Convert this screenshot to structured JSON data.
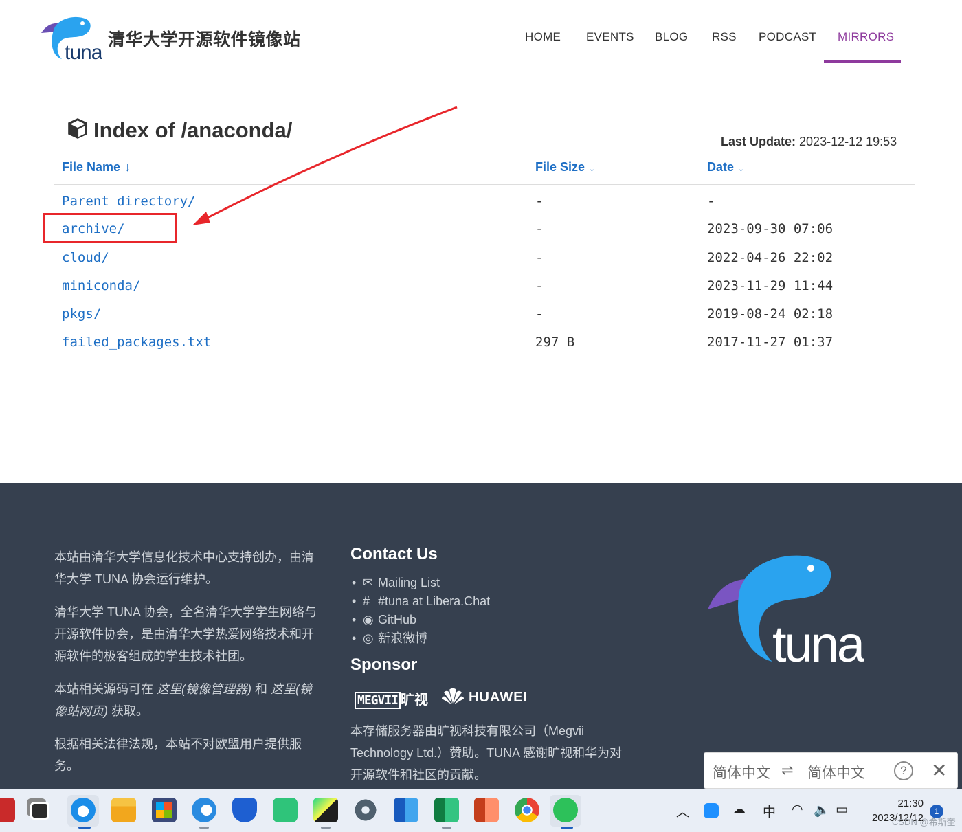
{
  "header": {
    "site_title": "清华大学开源软件镜像站",
    "logo_text": "tuna",
    "nav": [
      {
        "label": "HOME",
        "active": false
      },
      {
        "label": "EVENTS",
        "active": false
      },
      {
        "label": "BLOG",
        "active": false
      },
      {
        "label": "RSS",
        "active": false
      },
      {
        "label": "PODCAST",
        "active": false
      },
      {
        "label": "MIRRORS",
        "active": true
      }
    ],
    "accent_color": "#8e3a9d"
  },
  "index": {
    "title": "Index of /anaconda/",
    "last_update_label": "Last Update:",
    "last_update_value": "2023-12-12 19:53",
    "columns": {
      "name": "File Name",
      "size": "File Size",
      "date": "Date",
      "sort_arrow": "↓"
    },
    "rows": [
      {
        "name": "Parent directory/",
        "size": "-",
        "date": "-"
      },
      {
        "name": "archive/",
        "size": "-",
        "date": "2023-09-30 07:06"
      },
      {
        "name": "cloud/",
        "size": "-",
        "date": "2022-04-26 22:02"
      },
      {
        "name": "miniconda/",
        "size": "-",
        "date": "2023-11-29 11:44"
      },
      {
        "name": "pkgs/",
        "size": "-",
        "date": "2019-08-24 02:18"
      },
      {
        "name": "failed_packages.txt",
        "size": "297 B",
        "date": "2017-11-27 01:37"
      }
    ],
    "link_color": "#1e6fc5"
  },
  "annotation": {
    "color": "#e8262b"
  },
  "footer": {
    "about": {
      "p1": "本站由清华大学信息化技术中心支持创办，由清华大学 TUNA 协会运行维护。",
      "p2": "清华大学 TUNA 协会，全名清华大学学生网络与开源软件协会，是由清华大学热爱网络技术和开源软件的极客组成的学生技术社团。",
      "p3_a": "本站相关源码可在 ",
      "p3_link1": "这里(镜像管理器)",
      "p3_b": " 和 ",
      "p3_link2": "这里(镜像站网页)",
      "p3_c": " 获取。",
      "p4": "根据相关法律法规，本站不对欧盟用户提供服务。"
    },
    "contact_heading": "Contact Us",
    "contact_items": [
      {
        "icon": "envelope-icon",
        "label": "Mailing List"
      },
      {
        "icon": "hash-icon",
        "label": "#tuna at Libera.Chat"
      },
      {
        "icon": "github-icon",
        "label": "GitHub"
      },
      {
        "icon": "weibo-icon",
        "label": "新浪微博"
      }
    ],
    "sponsor_heading": "Sponsor",
    "sponsor_megvii_box": "MEGVII",
    "sponsor_megvii_cn": "旷视",
    "sponsor_huawei": "HUAWEI",
    "sponsor_text": "本存储服务器由旷视科技有限公司（Megvii Technology Ltd.）赞助。TUNA 感谢旷视和华为对开源软件和社区的贡献。",
    "logo_text": "tuna",
    "background": "#36404f"
  },
  "translate_popup": {
    "from": "简体中文",
    "swap": "⇌",
    "to": "简体中文",
    "help": "?",
    "close": "✕"
  },
  "taskbar": {
    "ime": "中",
    "time": "21:30",
    "date": "2023/12/12",
    "notifications": "1",
    "watermark": "CSDN @希斯奎"
  }
}
